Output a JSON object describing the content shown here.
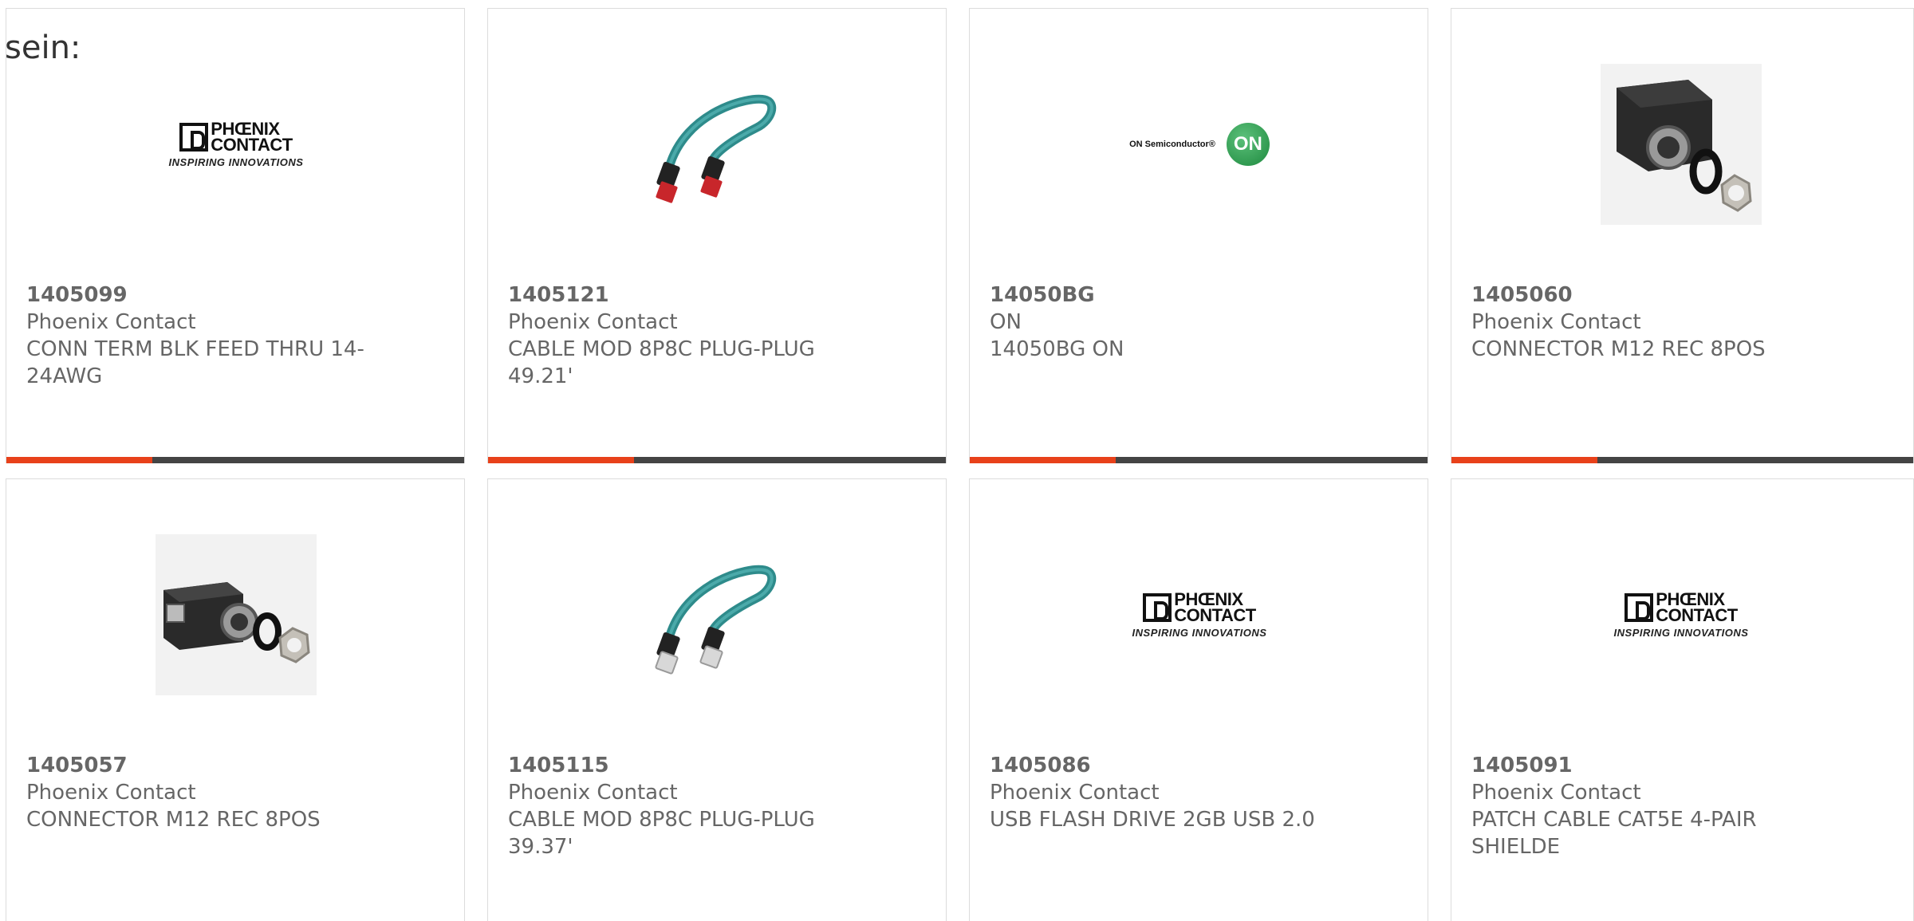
{
  "intro_text": "sein:",
  "accent_color": "#e8411a",
  "bar_color": "#444444",
  "cards": [
    {
      "part_number": "1405099",
      "manufacturer": "Phoenix Contact",
      "description": "CONN TERM BLK FEED THRU 14-24AWG",
      "image": "phoenix-contact-logo",
      "logo_line1": "PHŒNIX",
      "logo_line2": "CONTACT",
      "logo_tagline": "INSPIRING INNOVATIONS"
    },
    {
      "part_number": "1405121",
      "manufacturer": "Phoenix Contact",
      "description": "CABLE MOD 8P8C PLUG-PLUG 49.21'",
      "image": "ethernet-cable-red-plugs"
    },
    {
      "part_number": "14050BG",
      "manufacturer": "ON",
      "description": "14050BG ON",
      "image": "on-semiconductor-logo",
      "logo_text": "ON Semiconductor®",
      "logo_badge": "ON"
    },
    {
      "part_number": "1405060",
      "manufacturer": "Phoenix Contact",
      "description": "CONNECTOR M12 REC 8POS",
      "image": "m12-connector-housing"
    },
    {
      "part_number": "1405057",
      "manufacturer": "Phoenix Contact",
      "description": "CONNECTOR M12 REC 8POS",
      "image": "m12-connector-rj45"
    },
    {
      "part_number": "1405115",
      "manufacturer": "Phoenix Contact",
      "description": "CABLE MOD 8P8C PLUG-PLUG 39.37'",
      "image": "ethernet-cable-clear-plugs"
    },
    {
      "part_number": "1405086",
      "manufacturer": "Phoenix Contact",
      "description": "USB FLASH DRIVE 2GB USB 2.0",
      "image": "phoenix-contact-logo",
      "logo_line1": "PHŒNIX",
      "logo_line2": "CONTACT",
      "logo_tagline": "INSPIRING INNOVATIONS"
    },
    {
      "part_number": "1405091",
      "manufacturer": "Phoenix Contact",
      "description": "PATCH CABLE CAT5E 4-PAIR SHIELDE",
      "image": "phoenix-contact-logo",
      "logo_line1": "PHŒNIX",
      "logo_line2": "CONTACT",
      "logo_tagline": "INSPIRING INNOVATIONS"
    }
  ]
}
